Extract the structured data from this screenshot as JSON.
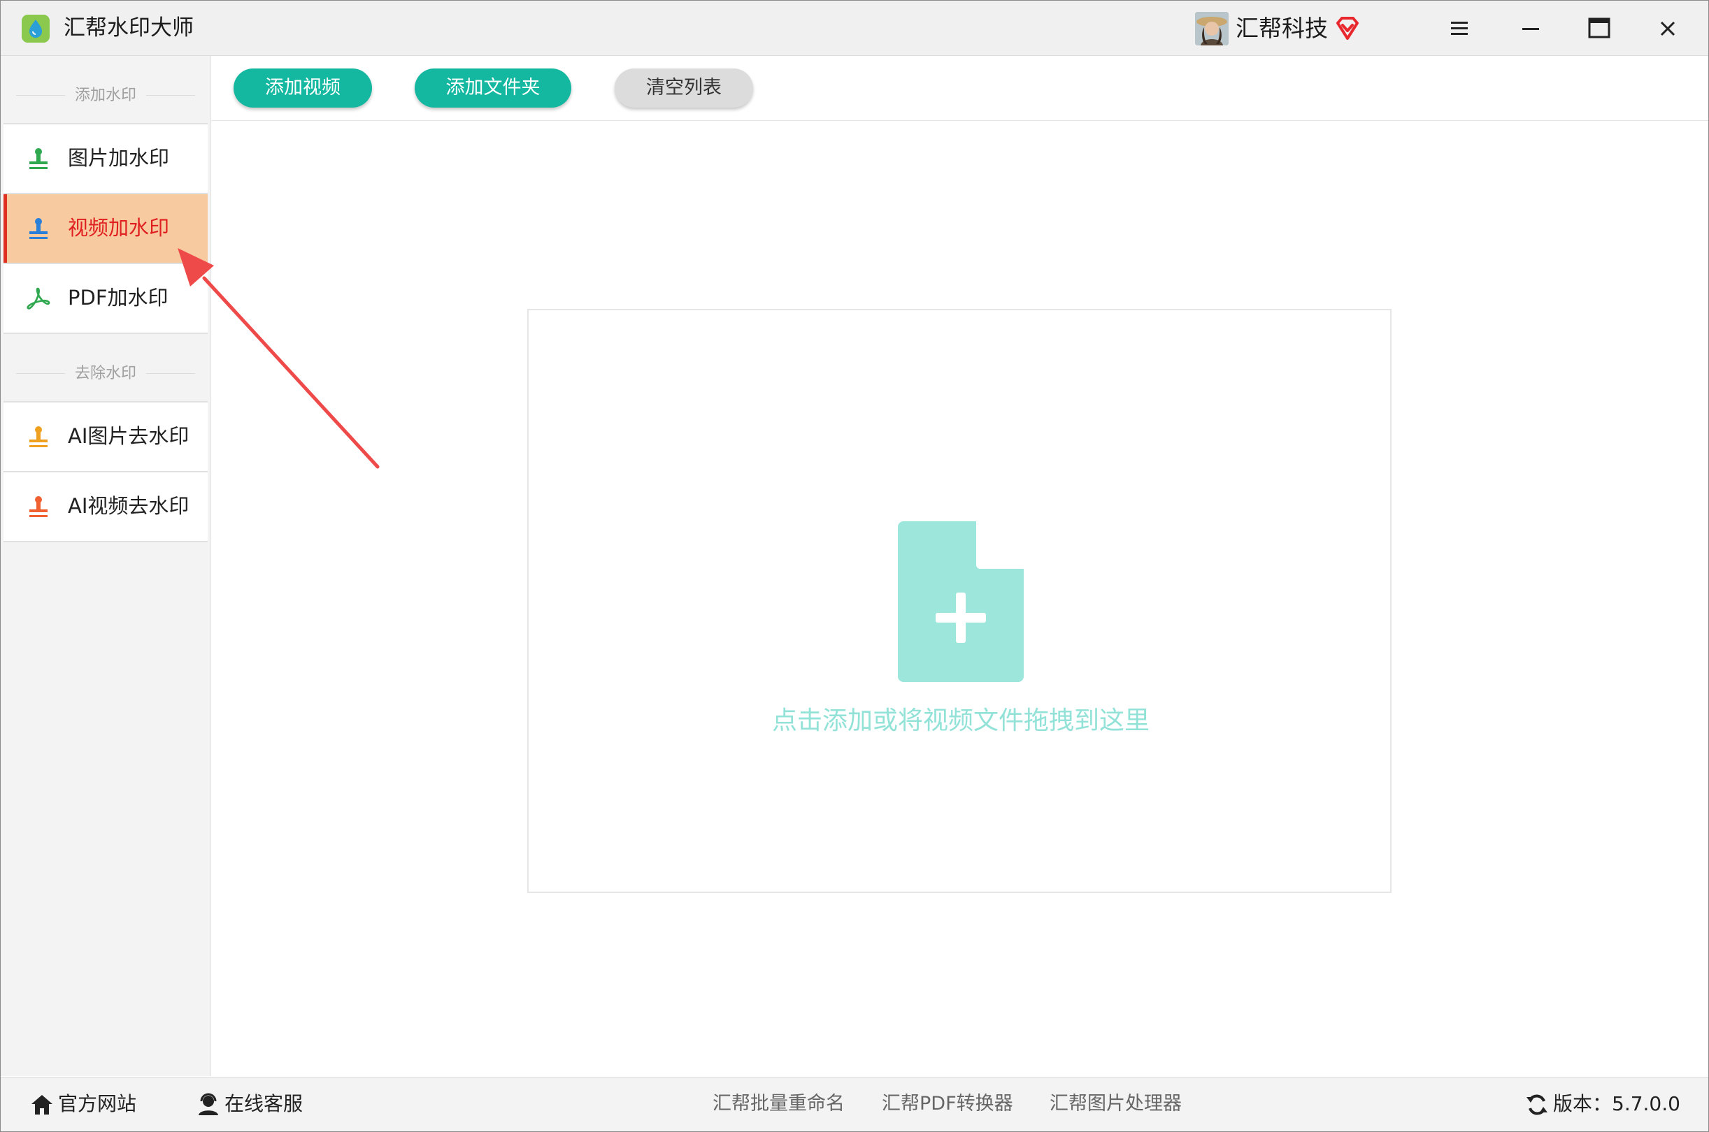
{
  "app": {
    "title": "汇帮水印大师",
    "company": "汇帮科技"
  },
  "colors": {
    "accent": "#14b8a0",
    "active_bg": "#f8caa0",
    "active_text": "#e02020",
    "drop_text": "#92e2d8"
  },
  "sidebar": {
    "section_add": "添加水印",
    "section_remove": "去除水印",
    "items": [
      {
        "label": "图片加水印",
        "icon": "stamp-green-icon"
      },
      {
        "label": "视频加水印",
        "icon": "stamp-blue-icon",
        "active": true
      },
      {
        "label": "PDF加水印",
        "icon": "pdf-icon"
      },
      {
        "label": "AI图片去水印",
        "icon": "stamp-orange-icon"
      },
      {
        "label": "AI视频去水印",
        "icon": "stamp-red-icon"
      }
    ]
  },
  "toolbar": {
    "add_video": "添加视频",
    "add_folder": "添加文件夹",
    "clear_list": "清空列表"
  },
  "main": {
    "drop_hint": "点击添加或将视频文件拖拽到这里"
  },
  "footer": {
    "official_site": "官方网站",
    "online_service": "在线客服",
    "links": [
      "汇帮批量重命名",
      "汇帮PDF转换器",
      "汇帮图片处理器"
    ],
    "version": "版本：5.7.0.0"
  }
}
